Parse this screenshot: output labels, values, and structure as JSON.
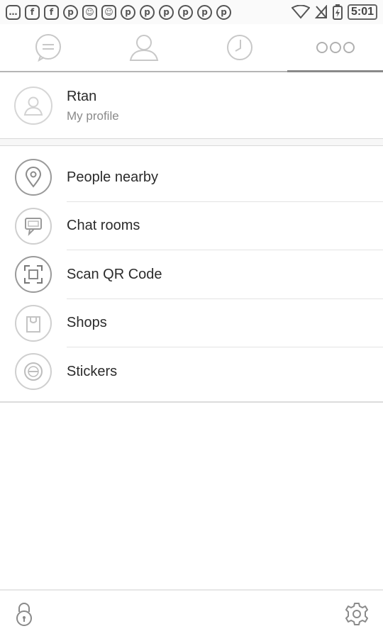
{
  "status_bar": {
    "notifications": [
      {
        "icon": "message-icon",
        "glyph": "…"
      },
      {
        "icon": "facebook-icon",
        "glyph": "f"
      },
      {
        "icon": "facebook-icon",
        "glyph": "f"
      },
      {
        "icon": "pinterest-icon",
        "glyph": "p"
      },
      {
        "icon": "cat-icon",
        "glyph": "☺"
      },
      {
        "icon": "cat-icon",
        "glyph": "☺"
      },
      {
        "icon": "pinterest-icon",
        "glyph": "p"
      },
      {
        "icon": "pinterest-icon",
        "glyph": "p"
      },
      {
        "icon": "pinterest-icon",
        "glyph": "p"
      },
      {
        "icon": "pinterest-icon",
        "glyph": "p"
      },
      {
        "icon": "pinterest-icon",
        "glyph": "p"
      },
      {
        "icon": "pinterest-icon",
        "glyph": "p"
      }
    ],
    "time": "5:01"
  },
  "tabs": [
    {
      "name": "tab-chats",
      "icon": "chat-icon"
    },
    {
      "name": "tab-contacts",
      "icon": "person-icon"
    },
    {
      "name": "tab-history",
      "icon": "clock-icon"
    },
    {
      "name": "tab-more",
      "icon": "more-icon",
      "active": true
    }
  ],
  "profile": {
    "name": "Rtan",
    "subtitle": "My profile"
  },
  "menu": [
    {
      "label": "People nearby",
      "icon": "location-pin-icon"
    },
    {
      "label": "Chat rooms",
      "icon": "chat-rooms-icon"
    },
    {
      "label": "Scan QR Code",
      "icon": "qr-scan-icon"
    },
    {
      "label": "Shops",
      "icon": "shop-bag-icon"
    },
    {
      "label": "Stickers",
      "icon": "sticker-icon"
    }
  ],
  "footer": {
    "left_icon": "lock-icon",
    "right_icon": "settings-gear-icon"
  }
}
